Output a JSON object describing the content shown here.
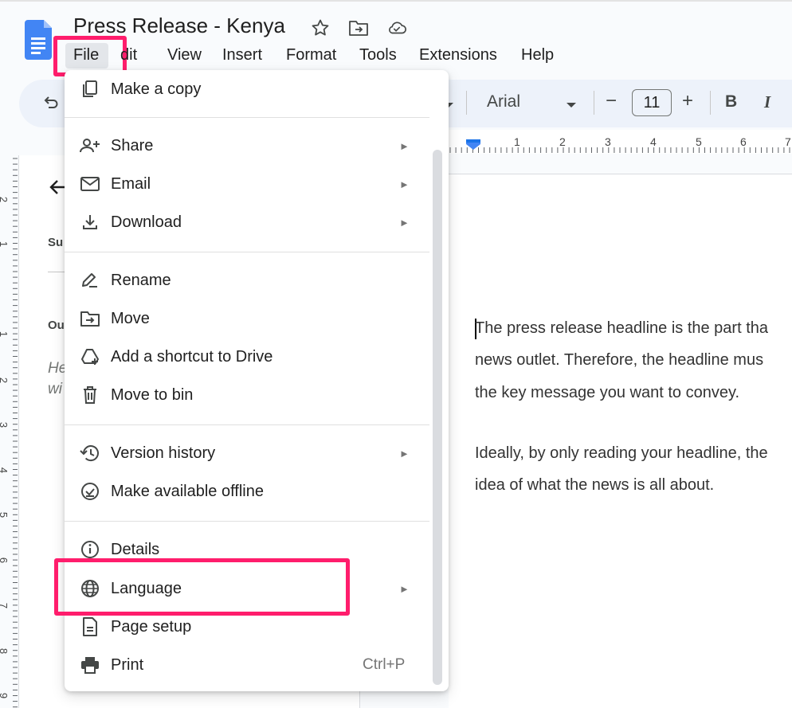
{
  "document": {
    "title": "Press Release - Kenya"
  },
  "menubar": [
    "File",
    "Edit",
    "View",
    "Insert",
    "Format",
    "Tools",
    "Extensions",
    "Help"
  ],
  "toolbar": {
    "font": "Arial",
    "font_size": "11",
    "minus": "−",
    "plus": "+",
    "bold": "B",
    "italic": "I"
  },
  "ruler": {
    "numbers": [
      "1",
      "2",
      "3",
      "4",
      "5",
      "6",
      "7"
    ],
    "vertical_numbers": [
      "2",
      "1",
      "1",
      "2",
      "3",
      "4",
      "5",
      "6",
      "7",
      "8",
      "9"
    ]
  },
  "outline": {
    "summary_fragment": "Su",
    "outline_fragment": "Ou",
    "placeholder_line1": "He",
    "placeholder_line2": "wi"
  },
  "file_menu": {
    "groups": [
      [
        {
          "label": "Make a copy",
          "icon": "copy-icon"
        }
      ],
      [
        {
          "label": "Share",
          "icon": "share-person-icon",
          "submenu": true
        },
        {
          "label": "Email",
          "icon": "email-icon",
          "submenu": true
        },
        {
          "label": "Download",
          "icon": "download-icon",
          "submenu": true
        }
      ],
      [
        {
          "label": "Rename",
          "icon": "rename-icon"
        },
        {
          "label": "Move",
          "icon": "move-folder-icon"
        },
        {
          "label": "Add a shortcut to Drive",
          "icon": "drive-shortcut-icon"
        },
        {
          "label": "Move to bin",
          "icon": "trash-icon"
        }
      ],
      [
        {
          "label": "Version history",
          "icon": "history-icon",
          "submenu": true
        },
        {
          "label": "Make available offline",
          "icon": "offline-icon"
        }
      ],
      [
        {
          "label": "Details",
          "icon": "info-icon"
        },
        {
          "label": "Language",
          "icon": "globe-icon",
          "submenu": true
        },
        {
          "label": "Page setup",
          "icon": "page-icon"
        },
        {
          "label": "Print",
          "icon": "print-icon",
          "shortcut": "Ctrl+P"
        }
      ]
    ],
    "submenu_arrow": "►"
  },
  "body_text": {
    "p1_l1": "The press release headline is the part tha",
    "p1_l2": "news outlet. Therefore, the headline mus",
    "p1_l3": "the key message you want to convey.",
    "p2_l1": "Ideally, by only reading your headline, the",
    "p2_l2": "idea of what the news is all about."
  },
  "colors": {
    "highlight": "#ff1d6c",
    "docs_blue": "#4285f4"
  }
}
